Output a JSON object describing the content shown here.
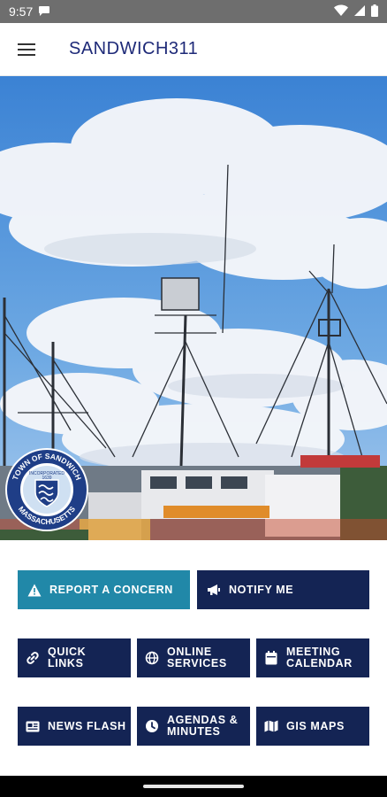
{
  "status_bar": {
    "time": "9:57",
    "icons": [
      "chat-bubble-icon",
      "wifi-icon",
      "signal-icon",
      "battery-icon"
    ]
  },
  "app_bar": {
    "title": "SANDWICH311",
    "menu_icon": "hamburger-menu-icon"
  },
  "hero": {
    "description_icon": "harbor-boats-photo",
    "seal": {
      "top_text": "TOWN OF SANDWICH",
      "bottom_text": "MASSACHUSETTS",
      "center_text": "INCORPORATED",
      "year": "1639"
    }
  },
  "buttons": [
    {
      "label": "REPORT A CONCERN",
      "icon": "warning-icon",
      "style": "teal"
    },
    {
      "label": "NOTIFY ME",
      "icon": "megaphone-icon",
      "style": "navy"
    },
    {
      "label": "QUICK\nLINKS",
      "icon": "link-icon",
      "style": "navy"
    },
    {
      "label": "ONLINE\nSERVICES",
      "icon": "globe-icon",
      "style": "navy"
    },
    {
      "label": "MEETING\nCALENDAR",
      "icon": "calendar-icon",
      "style": "navy"
    },
    {
      "label": "NEWS FLASH",
      "icon": "newspaper-icon",
      "style": "navy"
    },
    {
      "label": "AGENDAS &\nMINUTES",
      "icon": "clock-icon",
      "style": "navy"
    },
    {
      "label": "GIS MAPS",
      "icon": "map-icon",
      "style": "navy"
    }
  ],
  "colors": {
    "navy": "#142454",
    "teal": "#2188a8",
    "title": "#1e2a78"
  }
}
